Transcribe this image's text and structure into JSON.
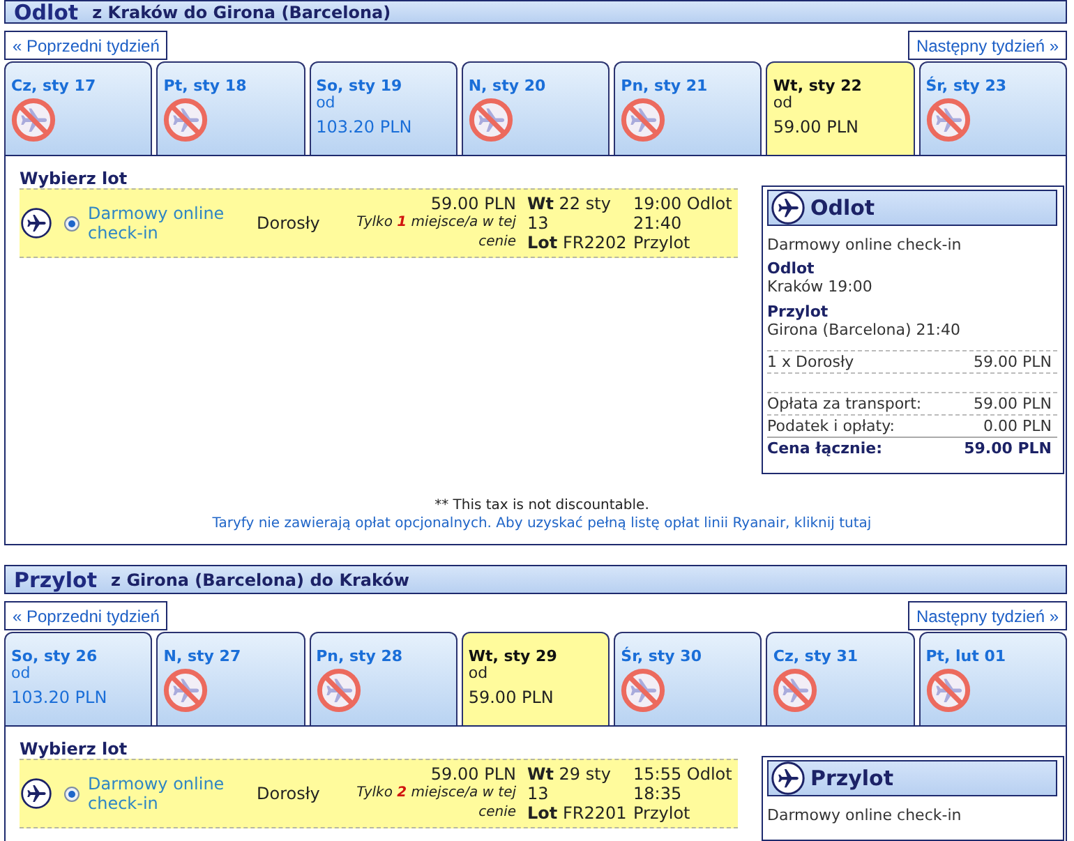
{
  "sections": [
    {
      "title": "Odlot",
      "route": "z Kraków do Girona (Barcelona)",
      "prev_week": "« Poprzedni tydzień",
      "next_week": "Następny tydzień »",
      "days": [
        {
          "label": "Cz, sty 17",
          "available": false,
          "selected": false
        },
        {
          "label": "Pt, sty 18",
          "available": false,
          "selected": false
        },
        {
          "label": "So, sty 19",
          "available": true,
          "selected": false,
          "from": "od",
          "price": "103.20 PLN"
        },
        {
          "label": "N, sty 20",
          "available": false,
          "selected": false
        },
        {
          "label": "Pn, sty 21",
          "available": false,
          "selected": false
        },
        {
          "label": "Wt, sty 22",
          "available": true,
          "selected": true,
          "from": "od",
          "price": "59.00 PLN"
        },
        {
          "label": "Śr, sty 23",
          "available": false,
          "selected": false
        }
      ],
      "choose_heading": "Wybierz lot",
      "flights": [
        {
          "selected": true,
          "fare": "Darmowy online check-in",
          "passenger": "Dorosły",
          "price": "59.00 PLN",
          "seats_note": "Tylko **1** miejsce/a w tej cenie",
          "date": "**Wt** 22 sty 13",
          "flight_number": "**Lot** FR2202",
          "departure": "19:00 Odlot",
          "arrival_time": "21:40",
          "arrival_label": "Przylot"
        }
      ],
      "summary": {
        "title": "Odlot",
        "fare": "Darmowy online check-in",
        "legs": [
          {
            "label": "Odlot",
            "value": "Kraków 19:00"
          },
          {
            "label": "Przylot",
            "value": "Girona (Barcelona) 21:40"
          }
        ],
        "passengers": [
          {
            "label": "1 x Dorosły",
            "amount": "59.00 PLN"
          }
        ],
        "charges": [
          {
            "label": "Opłata za transport:",
            "amount": "59.00 PLN"
          },
          {
            "label": "Podatek i opłaty:",
            "amount": "0.00 PLN"
          }
        ],
        "total": {
          "label": "Cena łącznie:",
          "amount": "59.00 PLN"
        }
      },
      "notes": {
        "tax": "** This tax is not discountable.",
        "fees_link": "Taryfy nie zawierają opłat opcjonalnych. Aby uzyskać pełną listę opłat linii Ryanair, kliknij tutaj"
      }
    },
    {
      "title": "Przylot",
      "route": "z Girona (Barcelona) do Kraków",
      "prev_week": "« Poprzedni tydzień",
      "next_week": "Następny tydzień »",
      "days": [
        {
          "label": "So, sty 26",
          "available": true,
          "selected": false,
          "from": "od",
          "price": "103.20 PLN"
        },
        {
          "label": "N, sty 27",
          "available": false,
          "selected": false
        },
        {
          "label": "Pn, sty 28",
          "available": false,
          "selected": false
        },
        {
          "label": "Wt, sty 29",
          "available": true,
          "selected": true,
          "from": "od",
          "price": "59.00 PLN"
        },
        {
          "label": "Śr, sty 30",
          "available": false,
          "selected": false
        },
        {
          "label": "Cz, sty 31",
          "available": false,
          "selected": false
        },
        {
          "label": "Pt, lut 01",
          "available": false,
          "selected": false
        }
      ],
      "choose_heading": "Wybierz lot",
      "flights": [
        {
          "selected": true,
          "fare": "Darmowy online check-in",
          "passenger": "Dorosły",
          "price": "59.00 PLN",
          "seats_note": "Tylko **2** miejsce/a w tej cenie",
          "date": "**Wt** 29 sty 13",
          "flight_number": "**Lot** FR2201",
          "departure": "15:55 Odlot",
          "arrival_time": "18:35",
          "arrival_label": "Przylot"
        }
      ],
      "summary": {
        "title": "Przylot",
        "fare": "Darmowy online check-in"
      }
    }
  ]
}
